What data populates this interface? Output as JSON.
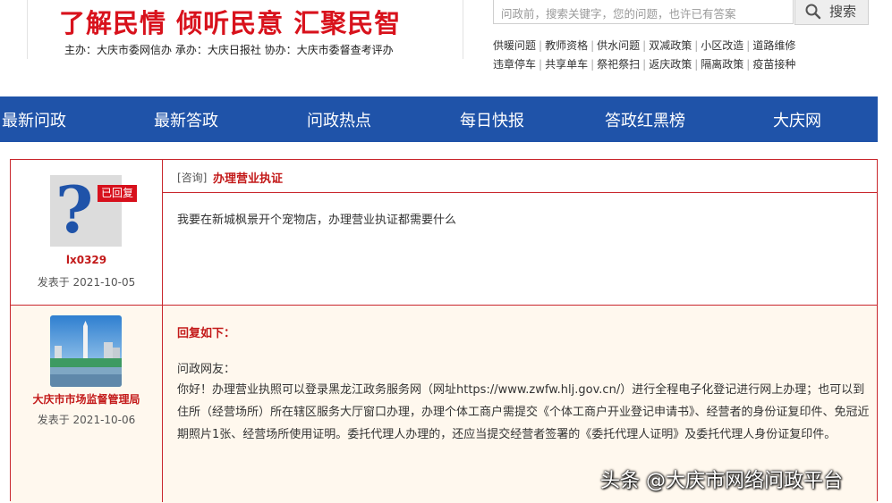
{
  "header": {
    "slogan": "了解民情  倾听民意  汇聚民智",
    "sponsor": "主办：大庆市委网信办   承办：大庆日报社   协办：大庆市委督查考评办"
  },
  "search": {
    "placeholder": "问政前，搜索关键字，您的问题，也许已有答案",
    "button_label": "搜索"
  },
  "hot_tags": {
    "row1": [
      "供暖问题",
      "教师资格",
      "供水问题",
      "双减政策",
      "小区改造",
      "道路维修"
    ],
    "row2": [
      "违章停车",
      "共享单车",
      "祭祀祭扫",
      "返庆政策",
      "隔离政策",
      "疫苗接种"
    ]
  },
  "nav": {
    "items": [
      "最新问政",
      "最新答政",
      "问政热点",
      "每日快报",
      "答政红黑榜",
      "大庆网"
    ]
  },
  "question": {
    "tag": "[咨询]",
    "title": "办理营业执证",
    "badge": "已回复",
    "user": "lx0329",
    "date": "发表于  2021-10-05",
    "body": "我要在新城枫景开个宠物店，办理营业执证都需要什么"
  },
  "answer": {
    "org": "大庆市市场监督管理局",
    "date": "发表于  2021-10-06",
    "heading": "回复如下：",
    "greeting": "问政网友：",
    "body": "你好！办理营业执照可以登录黑龙江政务服务网（网址https://www.zwfw.hlj.gov.cn/）进行全程电子化登记进行网上办理；也可以到住所（经营场所）所在辖区服务大厅窗口办理，办理个体工商户需提交《个体工商户开业登记申请书》、经营者的身份证复印件、免冠近期照片1张、经营场所使用证明。委托代理人办理的，还应当提交经营者签署的《委托代理人证明》及委托代理人身份证复印件。"
  },
  "watermark": "头条 @大庆市网络问政平台",
  "colors": {
    "nav_bg": "#1f53a9",
    "accent_red": "#c31a1a",
    "answer_bg": "#fff8ee"
  }
}
